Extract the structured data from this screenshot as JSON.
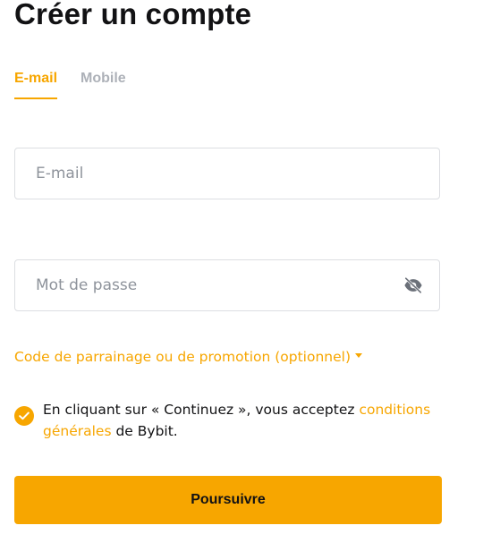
{
  "page": {
    "title": "Créer un compte"
  },
  "tabs": [
    {
      "label": "E-mail",
      "active": true
    },
    {
      "label": "Mobile",
      "active": false
    }
  ],
  "form": {
    "email": {
      "placeholder": "E-mail",
      "value": ""
    },
    "password": {
      "placeholder": "Mot de passe",
      "value": "",
      "toggle_icon": "eye-off-icon"
    }
  },
  "promo": {
    "label": "Code de parrainage ou de promotion (optionnel)",
    "caret_icon": "caret-down-icon"
  },
  "agreement": {
    "checked": true,
    "text_before": "En cliquant sur « Continuez », vous acceptez ",
    "link_label": "conditions générales",
    "text_after": " de Bybit."
  },
  "submit": {
    "label": "Poursuivre"
  },
  "colors": {
    "accent": "#f7a600",
    "text": "#121214",
    "muted": "#adb1b8",
    "border": "#dcdee2"
  }
}
